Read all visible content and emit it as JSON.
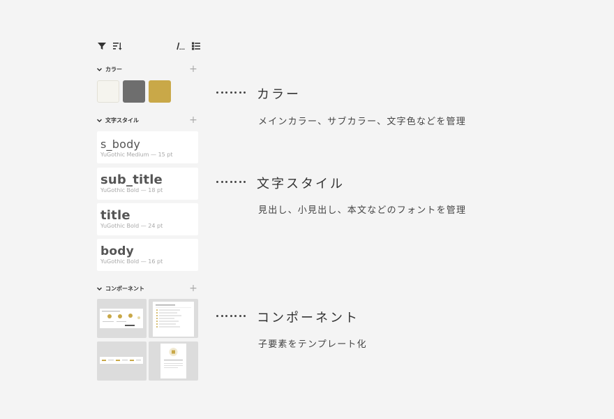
{
  "panel": {
    "colors_section": {
      "label": "カラー"
    },
    "swatches": [
      "#f5f4ee",
      "#6e6e6e",
      "#c9a848"
    ],
    "text_styles_section": {
      "label": "文字スタイル"
    },
    "text_styles": [
      {
        "name": "s_body",
        "meta": "YuGothic Medium — 15 pt"
      },
      {
        "name": "sub_title",
        "meta": "YuGothic Bold — 18 pt"
      },
      {
        "name": "title",
        "meta": "YuGothic Bold — 24 pt"
      },
      {
        "name": "body",
        "meta": "YuGothic Bold — 16 pt"
      }
    ],
    "components_section": {
      "label": "コンポーネント"
    }
  },
  "descriptions": {
    "colors": {
      "title": "カラー",
      "text": "メインカラー、サブカラー、文字色などを管理"
    },
    "text_styles": {
      "title": "文字スタイル",
      "text": "見出し、小見出し、本文などのフォントを管理"
    },
    "components": {
      "title": "コンポーネント",
      "text": "子要素をテンプレート化"
    }
  },
  "colors": {
    "accent": "#c9a848",
    "background": "#f4f4f4",
    "dark_gray": "#6e6e6e"
  }
}
